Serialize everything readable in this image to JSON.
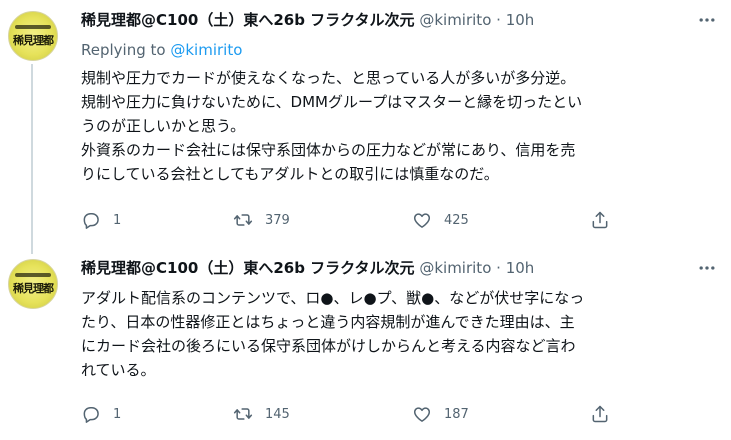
{
  "tweets": [
    {
      "author_name": "稀見理都@C100（土）東へ26b フラクタル次元",
      "handle": "@kimirito",
      "separator": "·",
      "time": "10h",
      "replying_prefix": "Replying to",
      "replying_to": "@kimirito",
      "lines": [
        "規制や圧力でカードが使えなくなった、と思っている人が多いが多分逆。",
        "規制や圧力に負けないために、DMMグループはマスターと縁を切ったとい",
        "うのが正しいかと思う。",
        "外資系のカード会社には保守系団体からの圧力などが常にあり、信用を売",
        "りにしている会社としてもアダルトとの取引には慎重なのだ。"
      ],
      "counts": {
        "replies": "1",
        "retweets": "379",
        "likes": "425"
      },
      "avatar_text": "稀見理都"
    },
    {
      "author_name": "稀見理都@C100（土）東へ26b フラクタル次元",
      "handle": "@kimirito",
      "separator": "·",
      "time": "10h",
      "lines": [
        "アダルト配信系のコンテンツで、ロ●、レ●プ、獣●、などが伏せ字になっ",
        "たり、日本の性器修正とはちょっと違う内容規制が進んできた理由は、主",
        "にカード会社の後ろにいる保守系団体がけしからんと考える内容など言わ",
        "れている。"
      ],
      "counts": {
        "replies": "1",
        "retweets": "145",
        "likes": "187"
      },
      "avatar_text": "稀見理都"
    }
  ],
  "icons": {
    "more": "more-icon",
    "reply": "reply-icon",
    "retweet": "retweet-icon",
    "like": "like-icon",
    "share": "share-icon"
  },
  "colors": {
    "text": "#0f1419",
    "secondary": "#536471",
    "link": "#1d9bf0",
    "thread_line": "#cfd9de",
    "avatar_yellow": "#e6e25a"
  }
}
